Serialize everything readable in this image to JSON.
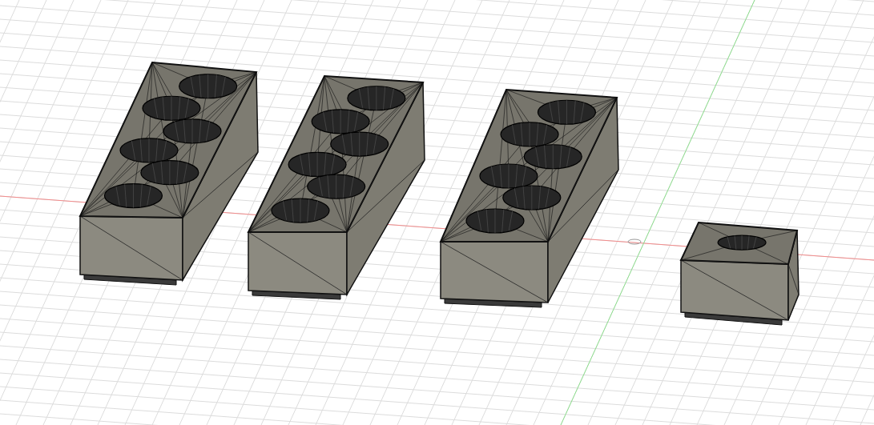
{
  "viewport": {
    "objects": [
      {
        "kind": "long-block"
      },
      {
        "kind": "long-block"
      },
      {
        "kind": "long-block"
      },
      {
        "kind": "short-block"
      }
    ]
  }
}
